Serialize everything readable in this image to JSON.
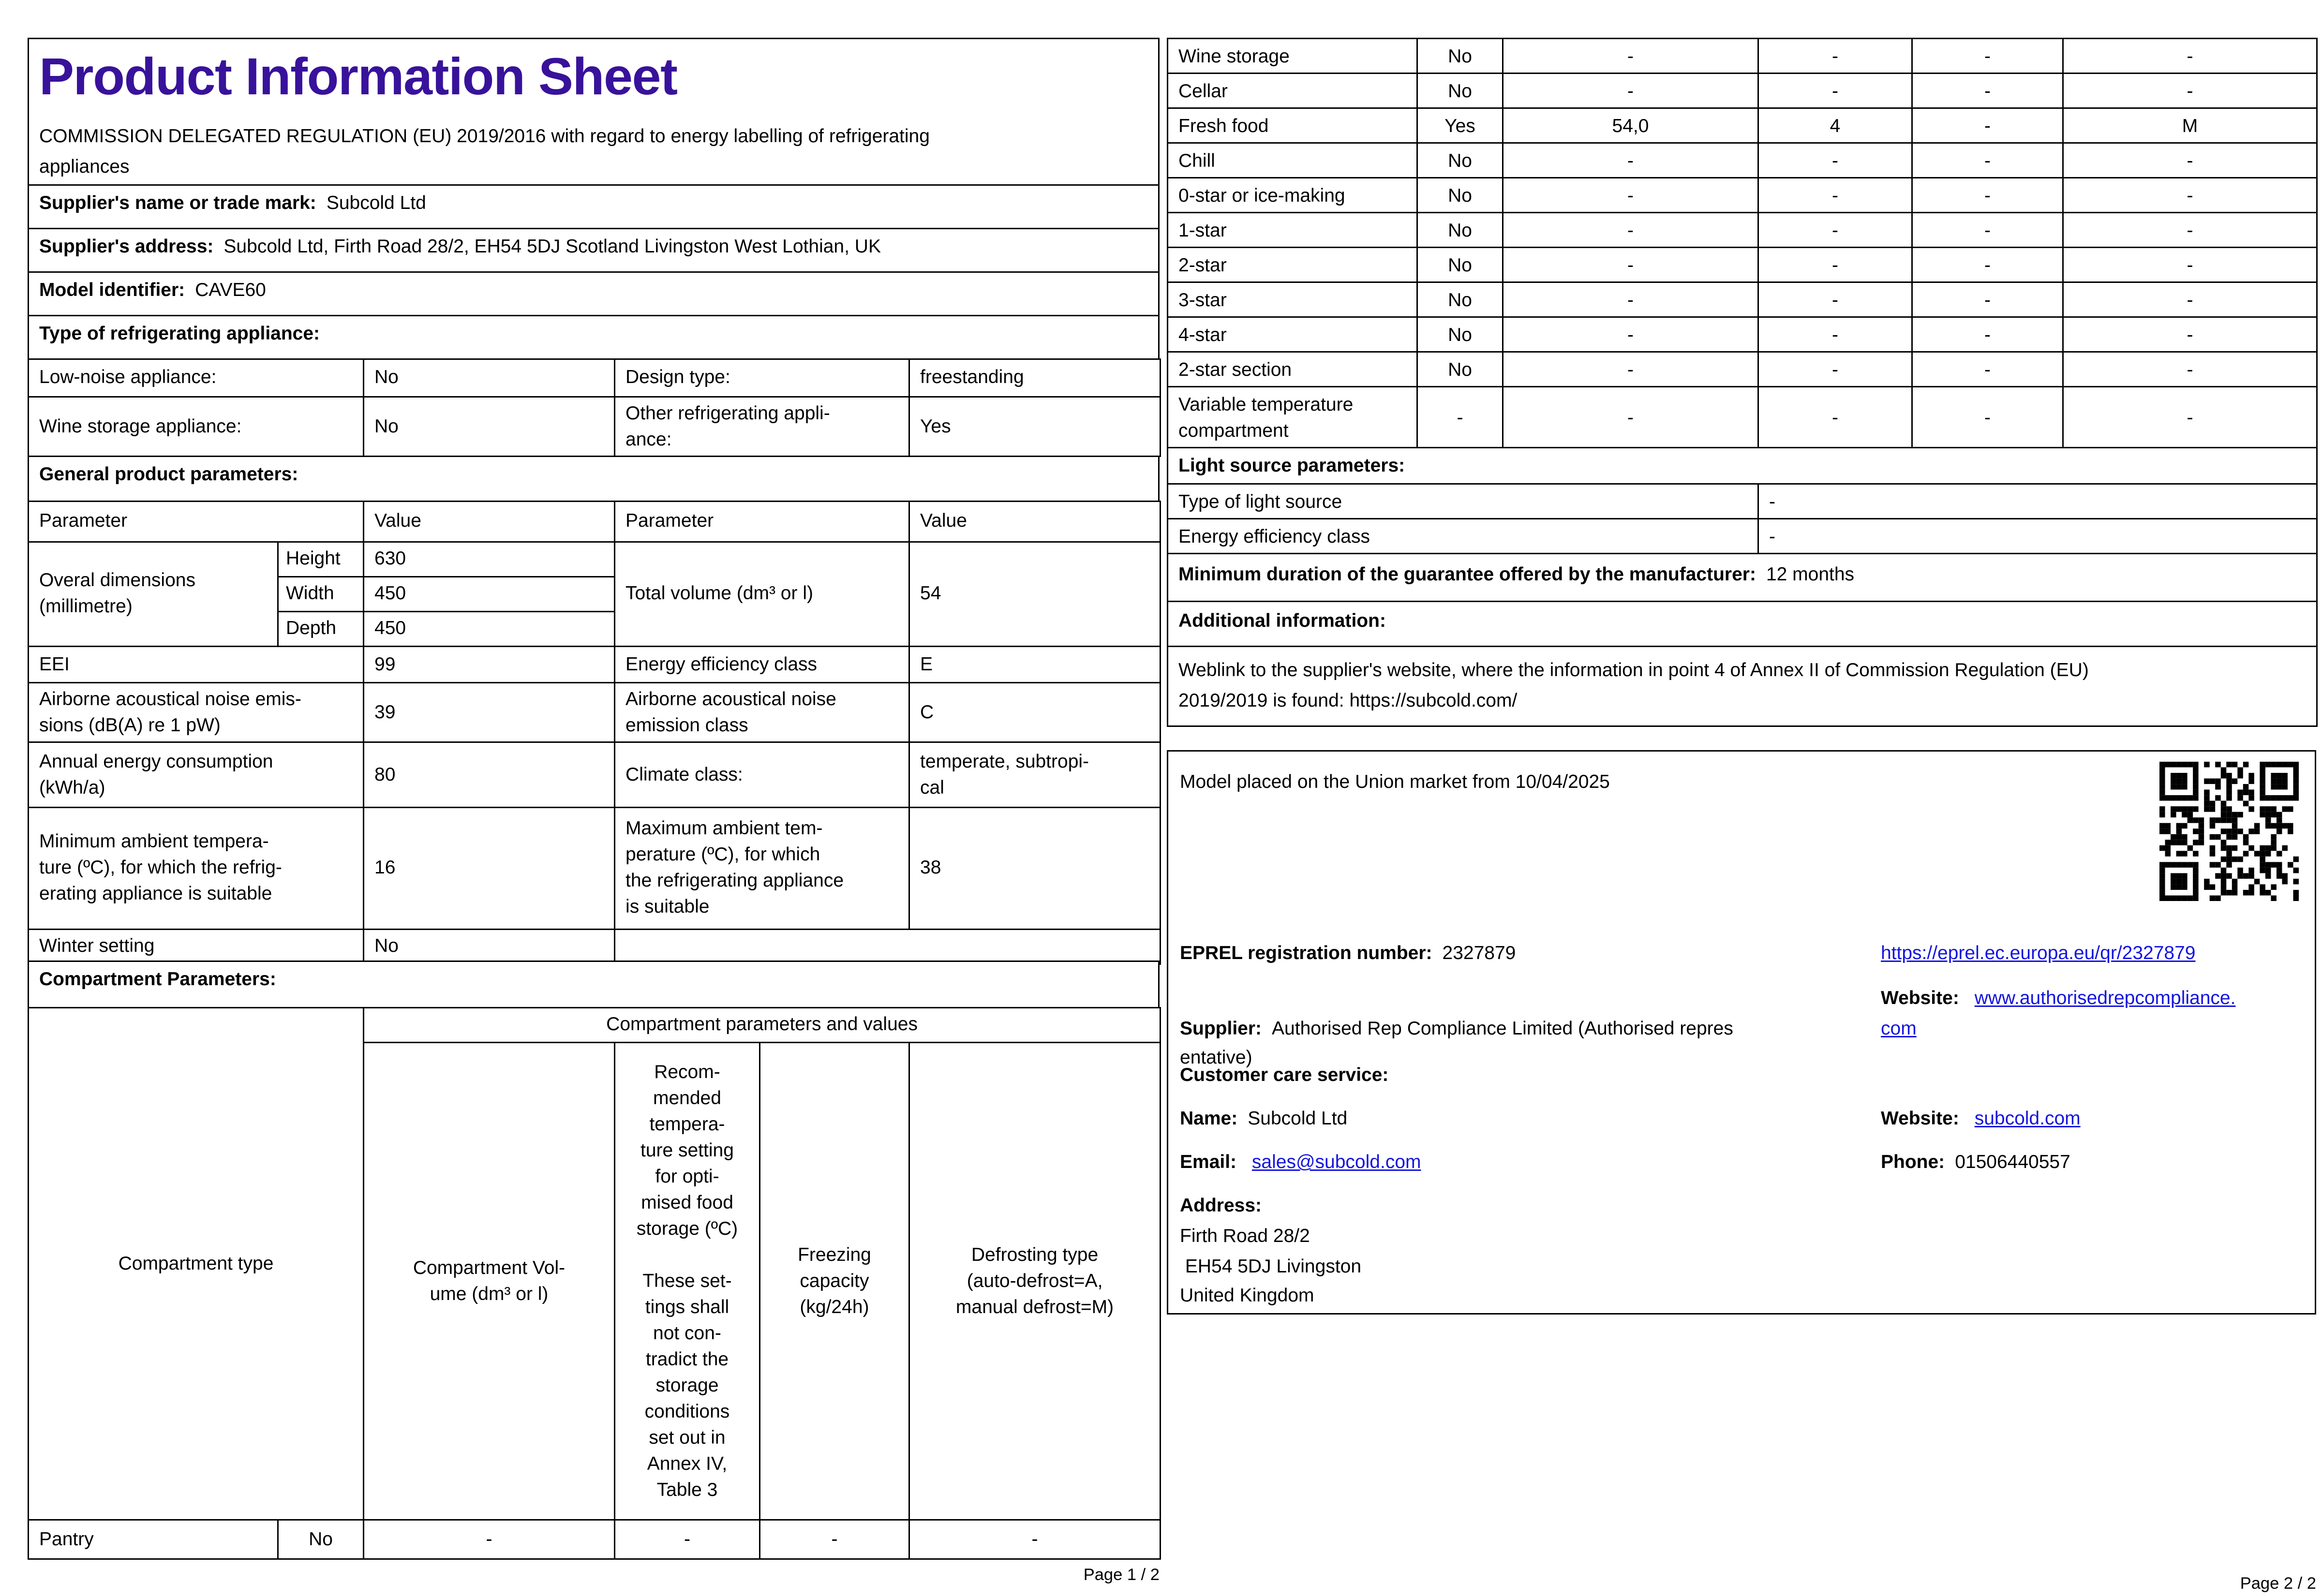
{
  "colors": {
    "title": "#38129b",
    "link": "#1414e0"
  },
  "page1": {
    "title": "Product Information Sheet",
    "subtitle": "COMMISSION DELEGATED REGULATION (EU) 2019/2016 with regard to energy labelling of refrigerating\nappliances",
    "supplier_name_label": "Supplier's name or trade mark:",
    "supplier_name_value": "Subcold Ltd",
    "supplier_address_label": "Supplier's address:",
    "supplier_address_value": "Subcold Ltd, Firth Road 28/2, EH54 5DJ Scotland Livingston West Lothian, UK",
    "model_label": "Model identifier:",
    "model_value": "CAVE60",
    "type_heading": "Type of refrigerating appliance:",
    "type_rows": [
      [
        "Low-noise appliance:",
        "No",
        "Design type:",
        "freestanding"
      ],
      [
        "Wine storage appliance:",
        "No",
        "Other refrigerating appli-\nance:",
        "Yes"
      ]
    ],
    "general_heading": "General product parameters:",
    "param_header": [
      "Parameter",
      "Value",
      "Parameter",
      "Value"
    ],
    "dims_label": "Overal dimensions\n(millimetre)",
    "dims_rows": [
      [
        "Height",
        "630"
      ],
      [
        "Width",
        "450"
      ],
      [
        "Depth",
        "450"
      ]
    ],
    "total_volume_label": "Total volume (dm³ or l)",
    "total_volume_value": "54",
    "param_rows": [
      [
        "EEI",
        "99",
        "Energy efficiency class",
        "E"
      ],
      [
        "Airborne acoustical noise emis-\nsions (dB(A) re 1 pW)",
        "39",
        "Airborne acoustical noise\nemission class",
        "C"
      ],
      [
        "Annual energy consumption\n(kWh/a)",
        "80",
        "Climate class:",
        "temperate, subtropi-\ncal"
      ],
      [
        "Minimum ambient tempera-\nture (ºC), for which the refrig-\nerating appliance is suitable",
        "16",
        "Maximum ambient tem-\nperature (ºC), for which\nthe refrigerating appliance\nis suitable",
        "38"
      ]
    ],
    "winter_label": "Winter setting",
    "winter_value": "No",
    "compartment_heading": "Compartment Parameters:",
    "group_header": "Compartment parameters and values",
    "col_compartment_type": "Compartment type",
    "col_volume": "Compartment Vol-\nume (dm³ or l)",
    "col_temp": "Recom-\nmended\ntempera-\nture setting\nfor opti-\nmised food\nstorage (ºC)\n\nThese set-\ntings shall\nnot con-\ntradict the\nstorage\nconditions\nset out in\nAnnex IV,\nTable 3",
    "col_freezing": "Freezing\ncapacity\n(kg/24h)",
    "col_defrost": "Defrosting type\n(auto-defrost=A,\nmanual defrost=M)",
    "rows": [
      [
        "Pantry",
        "No",
        "-",
        "-",
        "-",
        "-"
      ]
    ],
    "footer": "Page 1 / 2"
  },
  "page2": {
    "rows": [
      [
        "Wine storage",
        "No",
        "-",
        "-",
        "-",
        "-"
      ],
      [
        "Cellar",
        "No",
        "-",
        "-",
        "-",
        "-"
      ],
      [
        "Fresh food",
        "Yes",
        "54,0",
        "4",
        "-",
        "M"
      ],
      [
        "Chill",
        "No",
        "-",
        "-",
        "-",
        "-"
      ],
      [
        "0-star or ice-making",
        "No",
        "-",
        "-",
        "-",
        "-"
      ],
      [
        "1-star",
        "No",
        "-",
        "-",
        "-",
        "-"
      ],
      [
        "2-star",
        "No",
        "-",
        "-",
        "-",
        "-"
      ],
      [
        "3-star",
        "No",
        "-",
        "-",
        "-",
        "-"
      ],
      [
        "4-star",
        "No",
        "-",
        "-",
        "-",
        "-"
      ],
      [
        "2-star section",
        "No",
        "-",
        "-",
        "-",
        "-"
      ],
      [
        "Variable temperature\ncompartment",
        "-",
        "-",
        "-",
        "-",
        "-"
      ]
    ],
    "light_heading": "Light source parameters:",
    "light_rows": [
      [
        "Type of light source",
        "-"
      ],
      [
        "Energy efficiency class",
        "-"
      ]
    ],
    "guarantee_label": "Minimum duration of the guarantee offered by the manufacturer:",
    "guarantee_value": "12 months",
    "additional_heading": "Additional information:",
    "weblink_text": "Weblink to the supplier's website, where the information in point 4 of Annex II of Commission Regulation (EU)\n2019/2019 is found:  https://subcold.com/",
    "market_text": "Model placed on the Union market from 10/04/2025",
    "eprel_label": "EPREL registration number:",
    "eprel_value": "2327879",
    "eprel_link": "https://eprel.ec.europa.eu/qr/2327879",
    "supplier_label": "Supplier:",
    "supplier_value": "Authorised Rep Compliance Limited (Authorised repres\nentative)",
    "supplier_site_label": "Website:",
    "supplier_site_link": "www.authorisedrepcompliance.\ncom",
    "care_heading": "Customer care service:",
    "care_name_label": "Name:",
    "care_name_value": "Subcold Ltd",
    "care_site_label": "Website:",
    "care_site_link": "subcold.com",
    "care_email_label": "Email:",
    "care_email_link": "sales@subcold.com",
    "care_phone_label": "Phone:",
    "care_phone_value": "01506440557",
    "address_label": "Address:",
    "address_lines": "Firth Road 28/2\n EH54 5DJ Livingston\nUnited Kingdom",
    "footer": "Page 2 / 2"
  }
}
